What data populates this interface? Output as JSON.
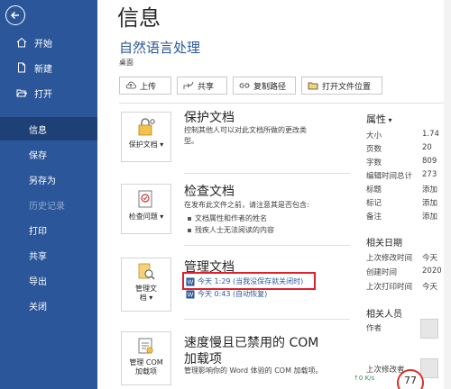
{
  "sidebar": {
    "items": [
      {
        "label": "开始"
      },
      {
        "label": "新建"
      },
      {
        "label": "打开"
      },
      {
        "label": "信息"
      },
      {
        "label": "保存"
      },
      {
        "label": "另存为"
      },
      {
        "label": "历史记录"
      },
      {
        "label": "打印"
      },
      {
        "label": "共享"
      },
      {
        "label": "导出"
      },
      {
        "label": "关闭"
      }
    ]
  },
  "header": {
    "page_title": "信息",
    "doc_title": "自然语言处理",
    "doc_location": "桌面"
  },
  "toolbar": {
    "upload": "上传",
    "share": "共享",
    "copy_path": "复制路径",
    "open_location": "打开文件位置"
  },
  "protect": {
    "tile": "保护文档",
    "title": "保护文档",
    "desc": "控制其他人可以对此文档所做的更改类型。"
  },
  "inspect": {
    "tile": "检查问题",
    "title": "检查文档",
    "desc": "在发布此文件之前，请注意其是否包含:",
    "bullets": [
      "文档属性和作者的姓名",
      "残疾人士无法阅读的内容"
    ]
  },
  "manage": {
    "tile_line1": "管理文",
    "tile_line2": "档",
    "title": "管理文档",
    "versions": [
      "今天 1:29 (当我没保存就关闭时)",
      "今天 0:43 (自动恢复)"
    ]
  },
  "com": {
    "tile_line1": "管理 COM",
    "tile_line2": "加载项",
    "title_line1": "速度慢且已禁用的 COM",
    "title_line2": "加载项",
    "desc": "管理影响你的 Word 体验的 COM 加载项。"
  },
  "properties": {
    "heading": "属性",
    "rows": [
      {
        "k": "大小",
        "v": "1.74"
      },
      {
        "k": "页数",
        "v": "20"
      },
      {
        "k": "字数",
        "v": "809"
      },
      {
        "k": "编辑时间总计",
        "v": "273"
      },
      {
        "k": "标题",
        "v": "添加"
      },
      {
        "k": "标记",
        "v": "添加"
      },
      {
        "k": "备注",
        "v": "添加"
      }
    ],
    "dates_heading": "相关日期",
    "dates": [
      {
        "k": "上次修改时间",
        "v": "今天"
      },
      {
        "k": "创建时间",
        "v": "2020"
      },
      {
        "k": "上次打印时间",
        "v": "今天"
      }
    ],
    "people_heading": "相关人员",
    "author_label": "作者",
    "last_modifier_label": "上次修改者"
  },
  "status": {
    "speed": "0",
    "speed_unit": "K/s",
    "badge": "77"
  },
  "colors": {
    "sidebar": "#2b579a",
    "active": "#1d4076",
    "highlight": "#e0202a"
  }
}
